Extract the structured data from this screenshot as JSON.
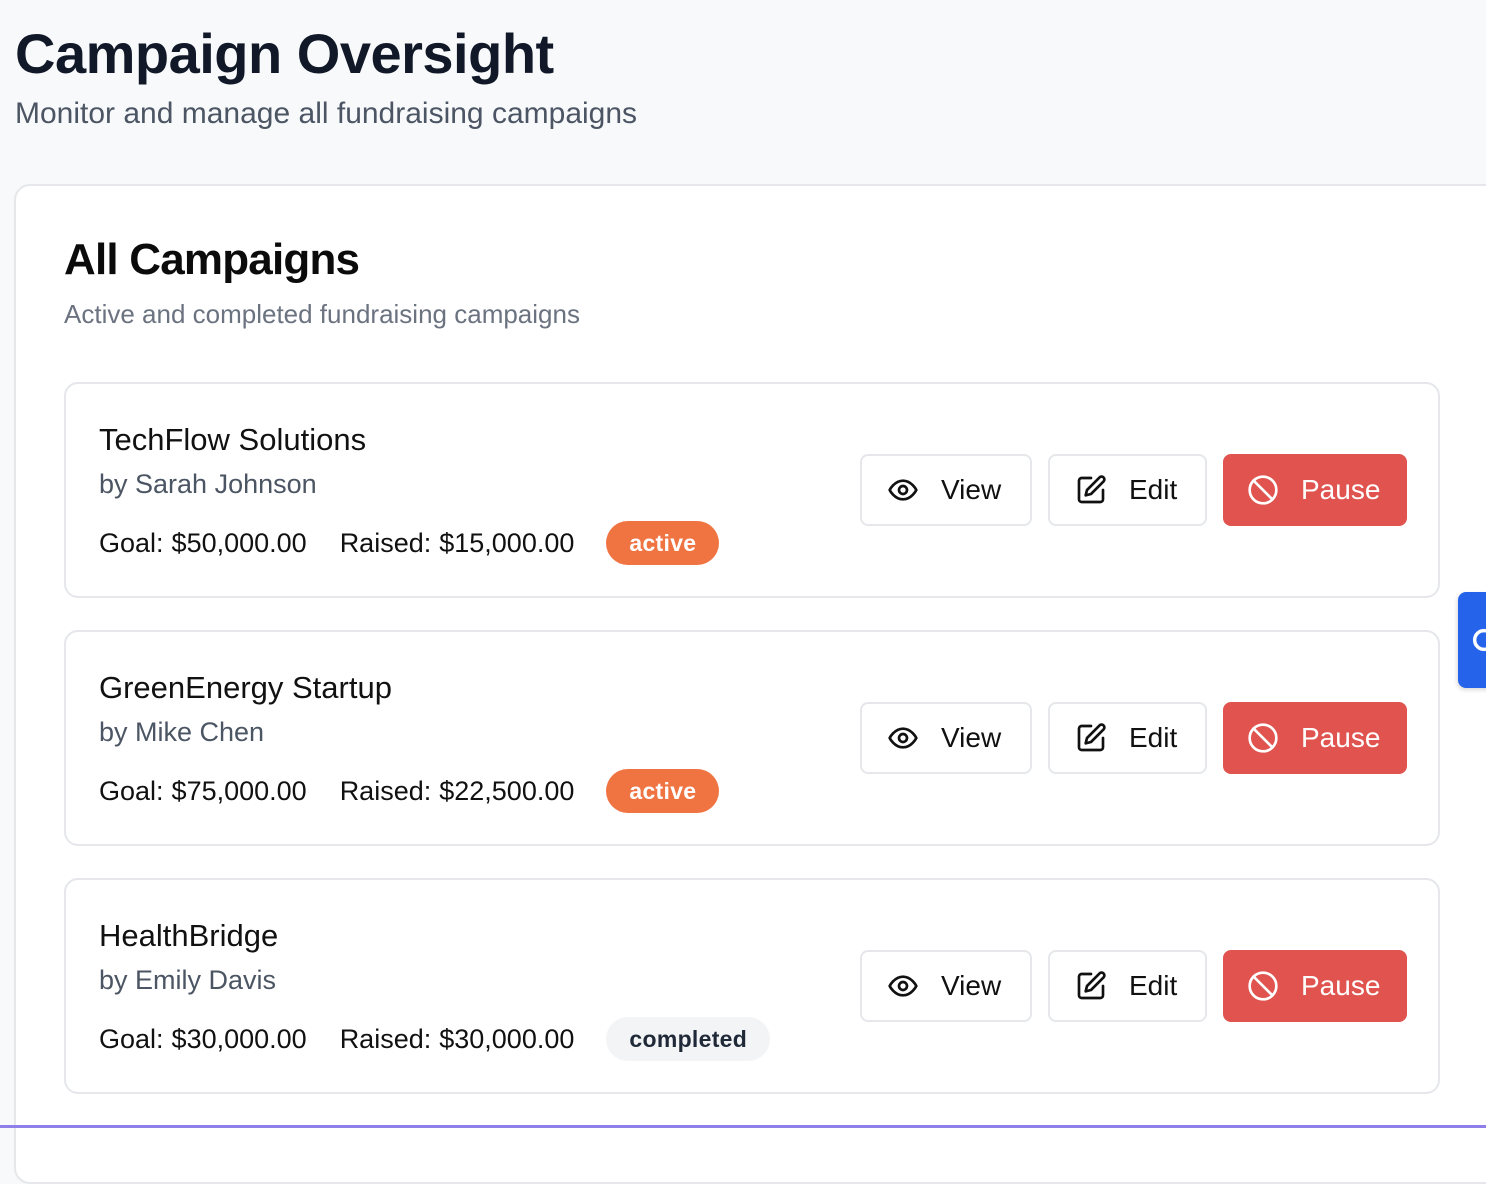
{
  "header": {
    "title": "Campaign Oversight",
    "subtitle": "Monitor and manage all fundraising campaigns"
  },
  "panel": {
    "title": "All Campaigns",
    "subtitle": "Active and completed fundraising campaigns"
  },
  "labels": {
    "goal": "Goal:",
    "raised": "Raised:"
  },
  "actions": {
    "view": "View",
    "edit": "Edit",
    "pause": "Pause"
  },
  "campaigns": [
    {
      "name": "TechFlow Solutions",
      "owner": "by Sarah Johnson",
      "goal": "$50,000.00",
      "raised": "$15,000.00",
      "status": "active"
    },
    {
      "name": "GreenEnergy Startup",
      "owner": "by Mike Chen",
      "goal": "$75,000.00",
      "raised": "$22,500.00",
      "status": "active"
    },
    {
      "name": "HealthBridge",
      "owner": "by Emily Davis",
      "goal": "$30,000.00",
      "raised": "$30,000.00",
      "status": "completed"
    }
  ],
  "colors": {
    "active_badge": "#ef7442",
    "completed_badge": "#f3f4f6",
    "pause_button": "#e0534e",
    "side_tab": "#2563eb"
  },
  "icons": {
    "view": "eye-icon",
    "edit": "edit-icon",
    "pause": "ban-icon",
    "side_tab": "chat-icon"
  }
}
